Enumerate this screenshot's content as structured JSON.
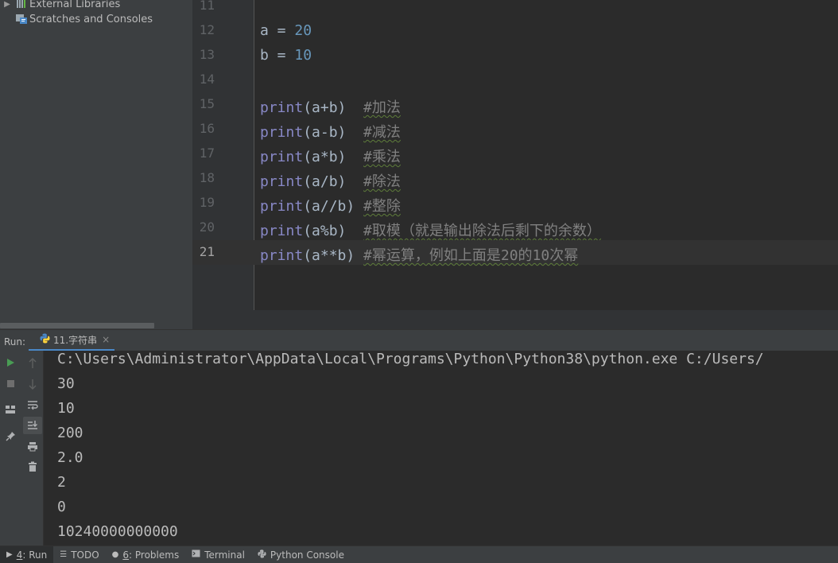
{
  "project_tree": {
    "items": [
      {
        "label": "External Libraries",
        "icon": "library-icon",
        "expanded": false
      },
      {
        "label": "Scratches and Consoles",
        "icon": "scratches-icon"
      }
    ]
  },
  "editor": {
    "current_line": "21",
    "lines": [
      {
        "num": "11",
        "tokens": []
      },
      {
        "num": "12",
        "tokens": [
          {
            "t": "a = ",
            "c": "plain"
          },
          {
            "t": "20",
            "c": "num"
          }
        ]
      },
      {
        "num": "13",
        "tokens": [
          {
            "t": "b = ",
            "c": "plain"
          },
          {
            "t": "10",
            "c": "num"
          }
        ]
      },
      {
        "num": "14",
        "tokens": []
      },
      {
        "num": "15",
        "tokens": [
          {
            "t": "print",
            "c": "builtin"
          },
          {
            "t": "(a+b)  ",
            "c": "plain"
          },
          {
            "t": "#加法",
            "c": "comment"
          }
        ]
      },
      {
        "num": "16",
        "tokens": [
          {
            "t": "print",
            "c": "builtin"
          },
          {
            "t": "(a-b)  ",
            "c": "plain"
          },
          {
            "t": "#减法",
            "c": "comment"
          }
        ]
      },
      {
        "num": "17",
        "tokens": [
          {
            "t": "print",
            "c": "builtin"
          },
          {
            "t": "(a*b)  ",
            "c": "plain"
          },
          {
            "t": "#乘法",
            "c": "comment"
          }
        ]
      },
      {
        "num": "18",
        "tokens": [
          {
            "t": "print",
            "c": "builtin"
          },
          {
            "t": "(a/b)  ",
            "c": "plain"
          },
          {
            "t": "#除法",
            "c": "comment"
          }
        ]
      },
      {
        "num": "19",
        "tokens": [
          {
            "t": "print",
            "c": "builtin"
          },
          {
            "t": "(a//b) ",
            "c": "plain"
          },
          {
            "t": "#整除",
            "c": "comment"
          }
        ]
      },
      {
        "num": "20",
        "tokens": [
          {
            "t": "print",
            "c": "builtin"
          },
          {
            "t": "(a%b)  ",
            "c": "plain"
          },
          {
            "t": "#取模（就是输出除法后剩下的余数）",
            "c": "comment"
          }
        ]
      },
      {
        "num": "21",
        "tokens": [
          {
            "t": "print",
            "c": "builtin"
          },
          {
            "t": "(a**b) ",
            "c": "plain"
          },
          {
            "t": "#幂运算，例如上面是20的10次幂",
            "c": "comment"
          }
        ]
      }
    ]
  },
  "run_panel": {
    "label": "Run:",
    "tab": {
      "label": "11.字符串",
      "close": "×"
    },
    "output": [
      "C:\\Users\\Administrator\\AppData\\Local\\Programs\\Python\\Python38\\python.exe C:/Users/",
      "30",
      "10",
      "200",
      "2.0",
      "2",
      "0",
      "10240000000000"
    ]
  },
  "bottom_bar": {
    "items": [
      {
        "mnemonic": "4",
        "label": ": Run",
        "icon": "run-triangle-icon",
        "active": true
      },
      {
        "mnemonic": "",
        "label": "TODO",
        "icon": "todo-list-icon",
        "active": false
      },
      {
        "mnemonic": "6",
        "label": ": Problems",
        "icon": "problems-icon",
        "active": false
      },
      {
        "mnemonic": "",
        "label": "Terminal",
        "icon": "terminal-icon",
        "active": false
      },
      {
        "mnemonic": "",
        "label": "Python Console",
        "icon": "python-console-icon",
        "active": false
      }
    ]
  },
  "colors": {
    "accent": "#4a88c7",
    "run_green": "#499c54",
    "number": "#6897bb",
    "builtin": "#8888c6",
    "comment": "#808080"
  }
}
